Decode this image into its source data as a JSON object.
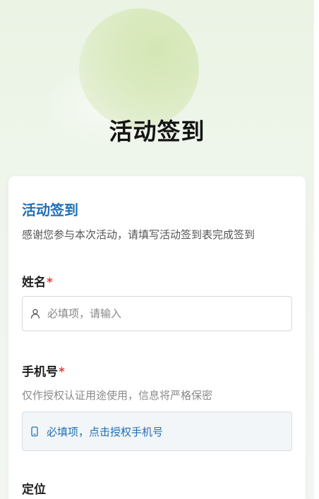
{
  "hero": {
    "title": "活动签到"
  },
  "card": {
    "title": "活动签到",
    "description": "感谢您参与本次活动，请填写活动签到表完成签到"
  },
  "fields": {
    "name": {
      "label": "姓名",
      "required_mark": "*",
      "placeholder": "必填项，请输入",
      "icon": "user-icon"
    },
    "phone": {
      "label": "手机号",
      "required_mark": "*",
      "help": "仅作授权认证用途使用，信息将严格保密",
      "action_text": "必填项，点击授权手机号",
      "icon": "mobile-phone-icon"
    },
    "location": {
      "label": "定位"
    }
  },
  "colors": {
    "accent": "#1f6fb5",
    "required": "#e0413a",
    "title": "#141414"
  }
}
